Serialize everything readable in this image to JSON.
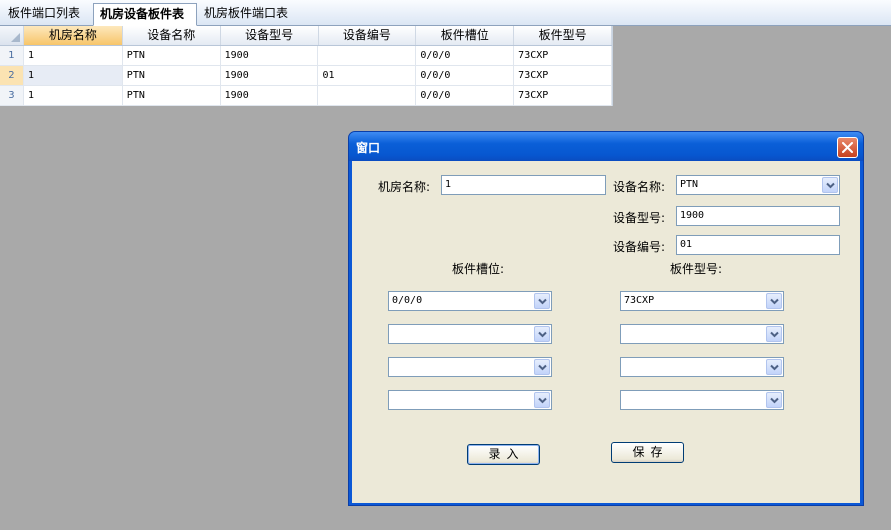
{
  "tabs": [
    {
      "label": "板件端口列表"
    },
    {
      "label": "机房设备板件表"
    },
    {
      "label": "机房板件端口表"
    }
  ],
  "grid": {
    "columns": [
      "机房名称",
      "设备名称",
      "设备型号",
      "设备编号",
      "板件槽位",
      "板件型号"
    ],
    "rows": [
      {
        "num": "1",
        "cells": [
          "1",
          "PTN",
          "1900",
          "",
          "0/0/0",
          "73CXP"
        ]
      },
      {
        "num": "2",
        "cells": [
          "1",
          "PTN",
          "1900",
          "01",
          "0/0/0",
          "73CXP"
        ]
      },
      {
        "num": "3",
        "cells": [
          "1",
          "PTN",
          "1900",
          "",
          "0/0/0",
          "73CXP"
        ]
      }
    ]
  },
  "dialog": {
    "title": "窗口",
    "room_name_label": "机房名称:",
    "room_name_value": "1",
    "device_name_label": "设备名称:",
    "device_name_value": "PTN",
    "device_model_label": "设备型号:",
    "device_model_value": "1900",
    "device_no_label": "设备编号:",
    "device_no_value": "01",
    "slot_label": "板件槽位:",
    "board_model_label": "板件型号:",
    "slots": [
      "0/0/0",
      "",
      "",
      ""
    ],
    "board_models": [
      "73CXP",
      "",
      "",
      ""
    ],
    "enter_button": "录入",
    "save_button": "保存"
  },
  "icons": {
    "close": "close-icon",
    "dropdown": "chevron-down-icon"
  }
}
